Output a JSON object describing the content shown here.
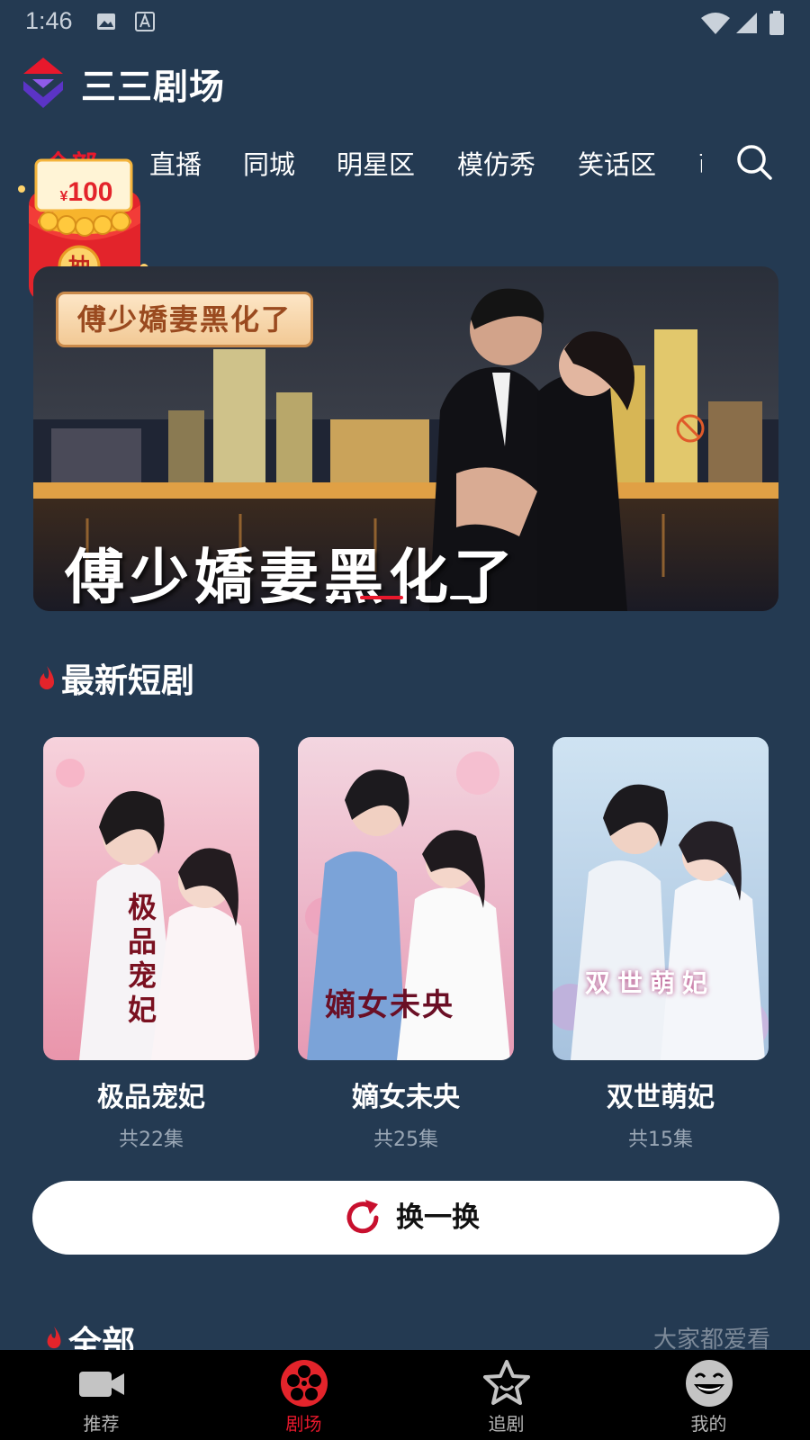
{
  "status_bar": {
    "time": "1:46"
  },
  "app": {
    "title": "三三剧场"
  },
  "tabs": [
    {
      "label": "全部",
      "active": true
    },
    {
      "label": "直播"
    },
    {
      "label": "同城"
    },
    {
      "label": "明星区"
    },
    {
      "label": "模仿秀"
    },
    {
      "label": "笑话区"
    },
    {
      "label": "萌"
    }
  ],
  "red_packet": {
    "amount": "100",
    "currency": "¥",
    "action": "抽"
  },
  "banner": {
    "tag": "傅少嬌妻黑化了",
    "title": "傅少嬌妻黑化了",
    "slide_count": 4,
    "active_slide": 2
  },
  "latest_section": {
    "title": "最新短剧"
  },
  "dramas": [
    {
      "name": "极品宠妃",
      "episodes": "共22集",
      "poster_text": "极品宠妃"
    },
    {
      "name": "嫡女未央",
      "episodes": "共25集",
      "poster_text": "嫡女未央"
    },
    {
      "name": "双世萌妃",
      "episodes": "共15集",
      "poster_text": "双世萌妃"
    }
  ],
  "refresh_button": {
    "label": "换一换"
  },
  "all_section": {
    "title": "全部",
    "more_link": "大家都爱看"
  },
  "bottom_nav": [
    {
      "label": "推荐",
      "icon": "video-camera-icon"
    },
    {
      "label": "剧场",
      "icon": "film-reel-icon",
      "active": true
    },
    {
      "label": "追剧",
      "icon": "star-icon"
    },
    {
      "label": "我的",
      "icon": "smiley-face-icon"
    }
  ],
  "colors": {
    "background": "#243a52",
    "accent": "#e8182c",
    "nav_background": "#000000"
  }
}
